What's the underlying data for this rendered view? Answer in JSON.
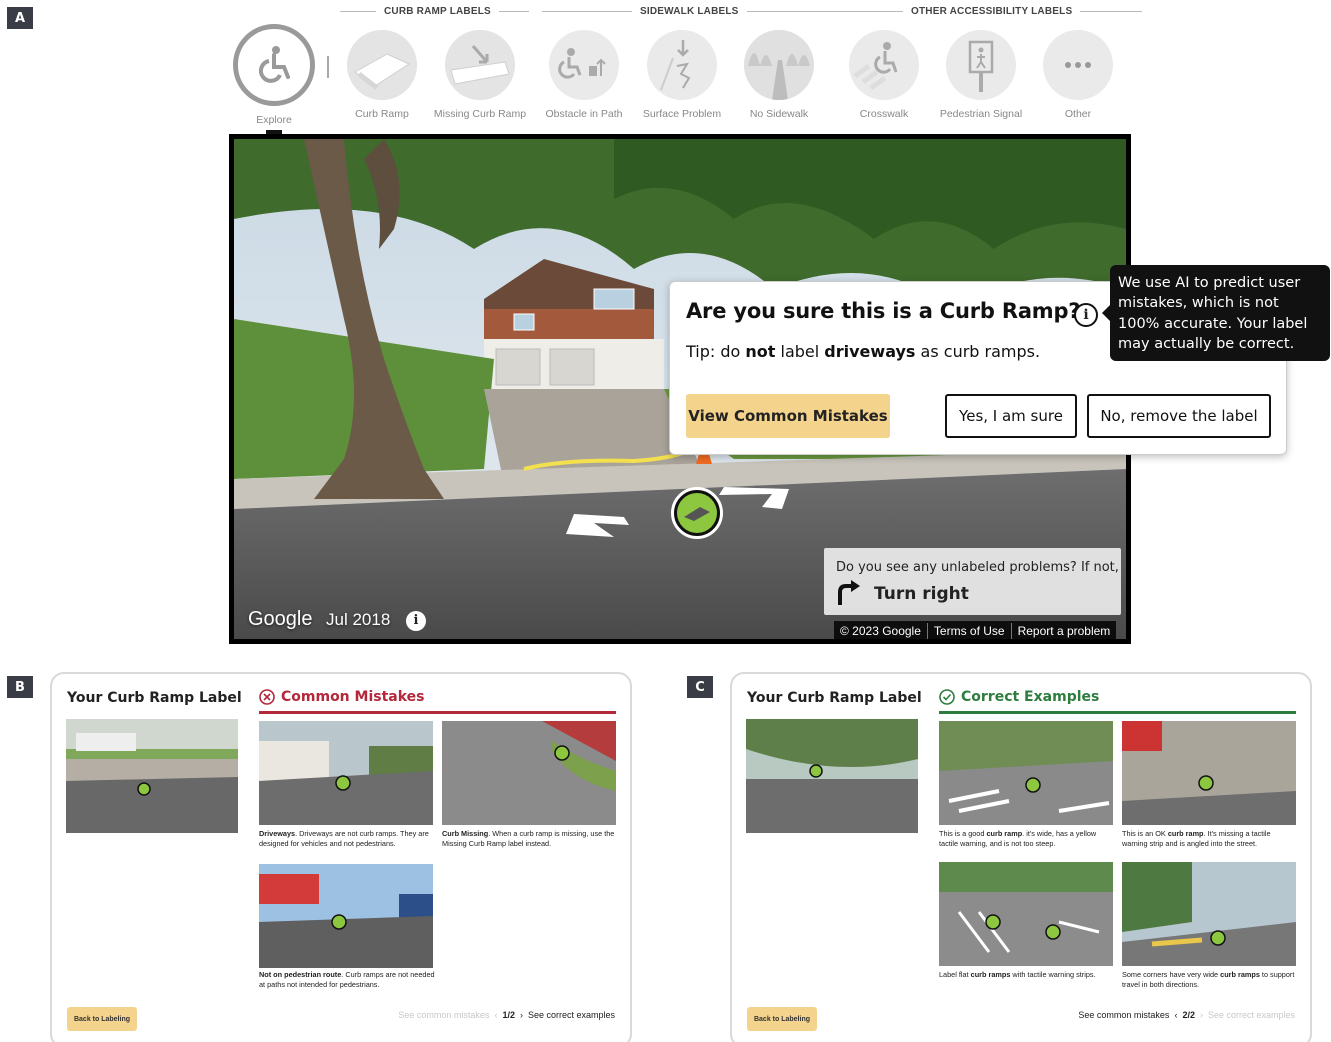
{
  "panels": {
    "a": "A",
    "b": "B",
    "c": "C"
  },
  "toolbar": {
    "groups": [
      "CURB RAMP LABELS",
      "SIDEWALK LABELS",
      "OTHER ACCESSIBILITY LABELS"
    ],
    "tools": [
      {
        "label": "Explore",
        "icon": "wheelchair-icon",
        "active": true
      },
      {
        "label": "Curb Ramp",
        "icon": "curb-ramp-icon"
      },
      {
        "label": "Missing Curb Ramp",
        "icon": "missing-curb-ramp-icon"
      },
      {
        "label": "Obstacle in Path",
        "icon": "obstacle-icon"
      },
      {
        "label": "Surface Problem",
        "icon": "surface-problem-icon"
      },
      {
        "label": "No Sidewalk",
        "icon": "no-sidewalk-icon"
      },
      {
        "label": "Crosswalk",
        "icon": "crosswalk-icon"
      },
      {
        "label": "Pedestrian Signal",
        "icon": "pedestrian-signal-icon"
      },
      {
        "label": "Other",
        "icon": "more-icon"
      }
    ]
  },
  "streetview": {
    "popup": {
      "title": "Are you sure this is a Curb Ramp?",
      "tip_prefix": "Tip: do ",
      "tip_not": "not",
      "tip_mid": " label ",
      "tip_driveways": "driveways",
      "tip_suffix": " as curb ramps.",
      "info_glyph": "i",
      "view_mistakes": "View Common Mistakes",
      "yes": "Yes, I am sure",
      "no": "No, remove the label"
    },
    "tooltip": "We use AI to predict user mistakes, which is not 100% accurate. Your label may actually be correct.",
    "turn_question": "Do you see any unlabeled problems? If not,",
    "turn_action": "Turn right",
    "watermark": "Google",
    "date": "Jul 2018",
    "info": "i",
    "footer": [
      "© 2023 Google",
      "Terms of Use",
      "Report a problem"
    ]
  },
  "mistakes_card": {
    "your_label": "Your Curb Ramp Label",
    "heading": "Common Mistakes",
    "heading_color": "#b3283a",
    "items": [
      {
        "bold": "Driveways",
        "text": ". Driveways are not curb ramps. They are designed for vehicles and not pedestrians."
      },
      {
        "bold": "Curb Missing",
        "text": ". When a curb ramp is missing, use the Missing Curb Ramp label instead."
      },
      {
        "bold": "Not on pedestrian route",
        "text": ". Curb ramps are not needed at paths not intended for pedestrians."
      }
    ],
    "back": "Back to Labeling",
    "prev": "See common mistakes",
    "page": "1/2",
    "next": "See correct examples"
  },
  "examples_card": {
    "your_label": "Your Curb Ramp Label",
    "heading": "Correct Examples",
    "heading_color": "#2e7d3e",
    "items": [
      {
        "pre": "This is a good ",
        "bold": "curb ramp",
        "text": ". it's wide, has a yellow tactile warning, and is not too steep."
      },
      {
        "pre": "This is an OK ",
        "bold": "curb ramp",
        "text": ". It's missing a tactile warning strip and is angled into the street."
      },
      {
        "pre": "Label flat ",
        "bold": "curb ramps",
        "text": " with tactile warning strips."
      },
      {
        "pre": "Some corners have very wide ",
        "bold": "curb ramps",
        "text": " to support travel in both directions."
      }
    ],
    "back": "Back to Labeling",
    "prev": "See common mistakes",
    "page": "2/2",
    "next": "See correct examples"
  },
  "colors": {
    "accent_yellow": "#f4d38d",
    "label_green": "#8dc63f"
  }
}
